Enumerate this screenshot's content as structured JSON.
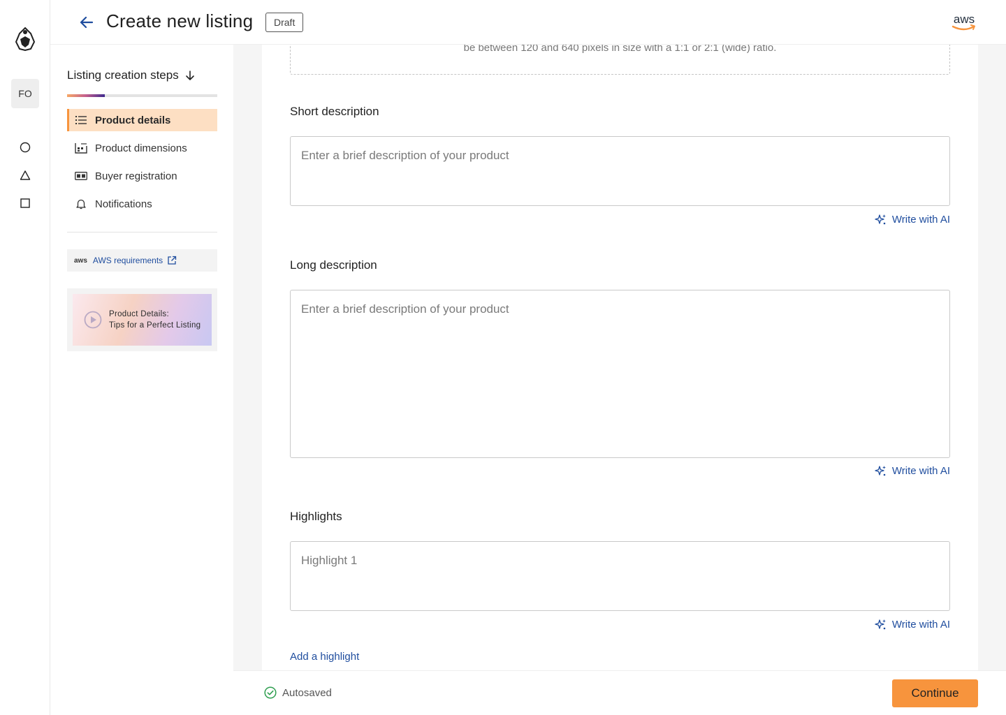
{
  "rail": {
    "avatar": "FO",
    "icons": [
      "circle-icon",
      "triangle-icon",
      "square-icon"
    ]
  },
  "header": {
    "title": "Create new listing",
    "status_badge": "Draft",
    "brand": "aws"
  },
  "sidebar": {
    "heading": "Listing creation steps",
    "progress": 0.25,
    "steps": [
      {
        "label": "Product details",
        "icon": "list-icon",
        "active": true
      },
      {
        "label": "Product dimensions",
        "icon": "dimensions-icon",
        "active": false
      },
      {
        "label": "Buyer registration",
        "icon": "id-card-icon",
        "active": false
      },
      {
        "label": "Notifications",
        "icon": "bell-icon",
        "active": false
      }
    ],
    "aws_link": {
      "badge": "aws",
      "label": "AWS requirements"
    },
    "video_card": {
      "line1": "Product Details:",
      "line2": "Tips for a Perfect Listing"
    }
  },
  "form": {
    "dropzone_hint": "be between 120 and 640 pixels in size with a 1:1 or 2:1 (wide) ratio.",
    "short_description": {
      "label": "Short description",
      "placeholder": "Enter a brief description of your product",
      "value": ""
    },
    "long_description": {
      "label": "Long description",
      "placeholder": "Enter a brief description of your product",
      "value": ""
    },
    "highlights": {
      "label": "Highlights",
      "placeholder": "Highlight 1",
      "value": ""
    },
    "ai_link_label": "Write with AI",
    "add_highlight_label": "Add a highlight"
  },
  "footer": {
    "autosave_status": "Autosaved",
    "continue_label": "Continue"
  },
  "colors": {
    "accent": "#f7943d",
    "active_step_bg": "#fddfc3",
    "link": "#1f4d9e",
    "success": "#2e9e4f"
  }
}
